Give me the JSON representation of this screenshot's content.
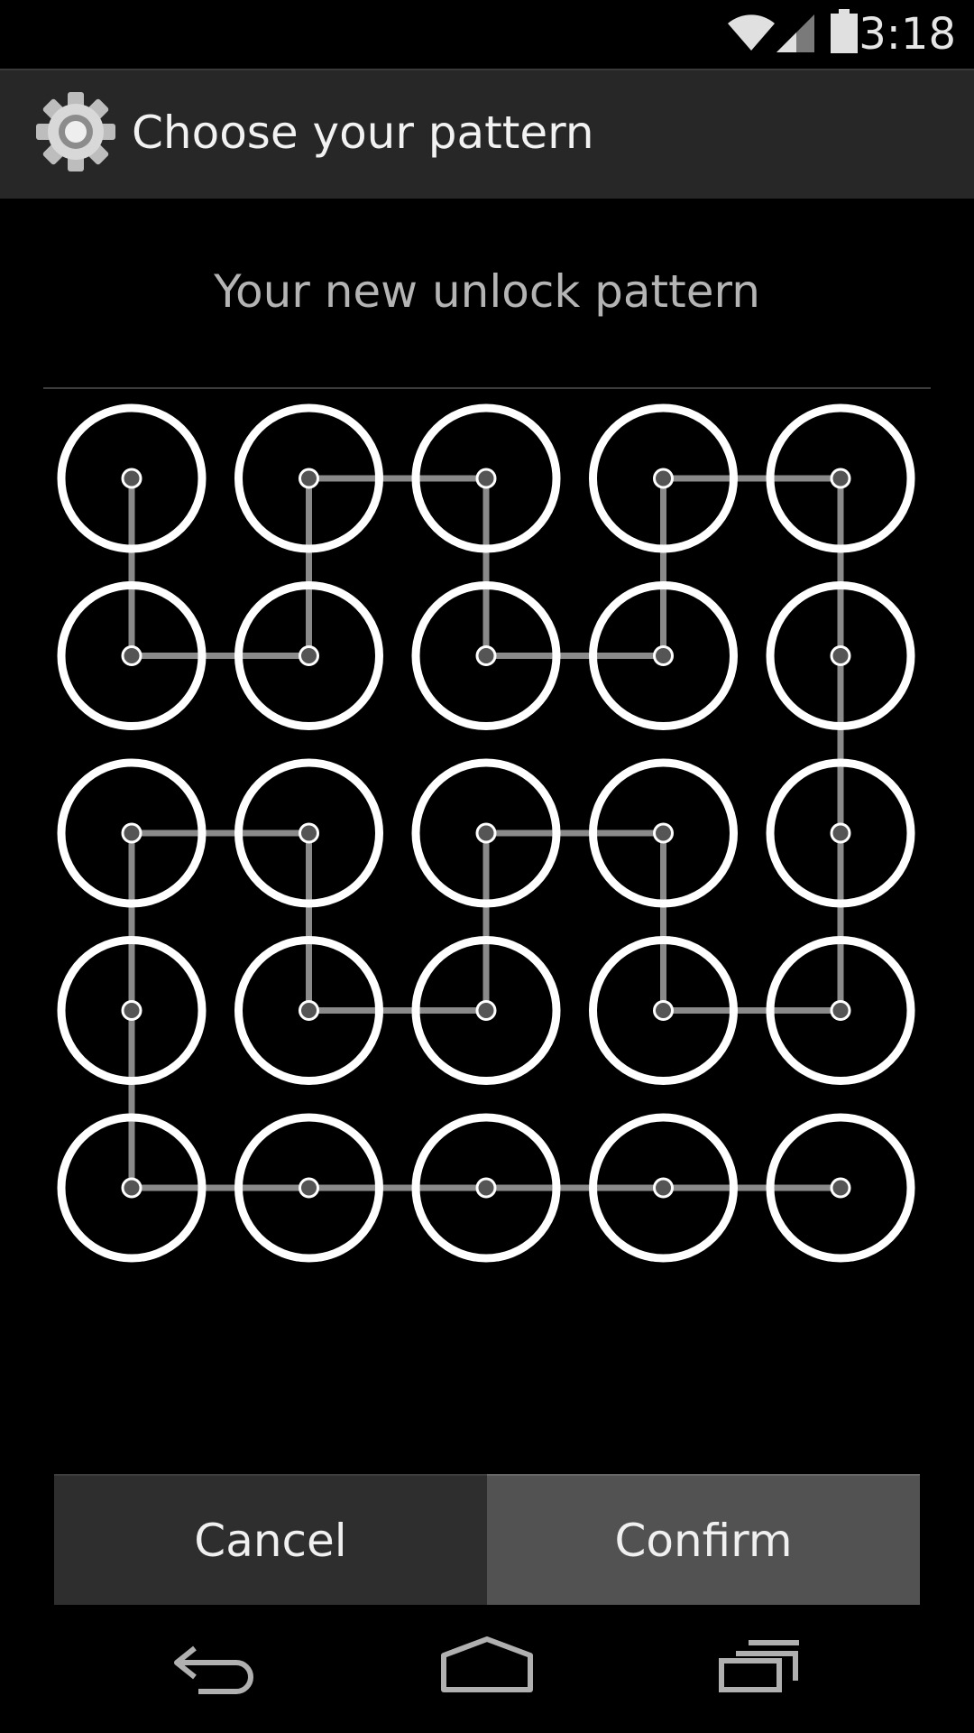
{
  "status_bar": {
    "time": "3:18",
    "icons": [
      "wifi-icon",
      "cell-signal-icon",
      "battery-icon"
    ]
  },
  "action_bar": {
    "title": "Choose your pattern",
    "icon": "settings-gear-icon"
  },
  "header": {
    "text": "Your new unlock pattern"
  },
  "pattern": {
    "rows": 5,
    "cols": 5,
    "dot_color": "#ffffff",
    "line_color": "#8a8a8a",
    "path": [
      [
        1,
        5
      ],
      [
        2,
        5
      ],
      [
        3,
        5
      ],
      [
        4,
        5
      ],
      [
        5,
        5
      ],
      [
        5,
        4
      ],
      [
        4,
        4
      ],
      [
        4,
        3
      ],
      [
        3,
        3
      ],
      [
        3,
        4
      ],
      [
        2,
        4
      ],
      [
        2,
        3
      ],
      [
        1,
        3
      ],
      [
        1,
        2
      ],
      [
        2,
        2
      ],
      [
        2,
        1
      ],
      [
        3,
        1
      ],
      [
        3,
        2
      ],
      [
        4,
        2
      ],
      [
        4,
        1
      ],
      [
        5,
        1
      ],
      [
        5,
        2
      ],
      [
        5,
        3
      ],
      [
        5,
        4
      ]
    ],
    "segments": [
      [
        [
          1,
          1
        ],
        [
          1,
          2
        ]
      ],
      [
        [
          1,
          2
        ],
        [
          2,
          2
        ]
      ],
      [
        [
          2,
          2
        ],
        [
          2,
          1
        ]
      ],
      [
        [
          2,
          1
        ],
        [
          3,
          1
        ]
      ],
      [
        [
          3,
          1
        ],
        [
          3,
          2
        ]
      ],
      [
        [
          3,
          2
        ],
        [
          4,
          2
        ]
      ],
      [
        [
          4,
          2
        ],
        [
          4,
          1
        ]
      ],
      [
        [
          4,
          1
        ],
        [
          5,
          1
        ]
      ],
      [
        [
          5,
          1
        ],
        [
          5,
          4
        ]
      ],
      [
        [
          1,
          3
        ],
        [
          2,
          3
        ]
      ],
      [
        [
          2,
          3
        ],
        [
          2,
          4
        ]
      ],
      [
        [
          2,
          4
        ],
        [
          3,
          4
        ]
      ],
      [
        [
          3,
          4
        ],
        [
          3,
          3
        ]
      ],
      [
        [
          3,
          3
        ],
        [
          4,
          3
        ]
      ],
      [
        [
          4,
          3
        ],
        [
          4,
          4
        ]
      ],
      [
        [
          4,
          4
        ],
        [
          5,
          4
        ]
      ],
      [
        [
          1,
          3
        ],
        [
          1,
          5
        ]
      ],
      [
        [
          1,
          5
        ],
        [
          5,
          5
        ]
      ]
    ]
  },
  "buttons": {
    "cancel": "Cancel",
    "confirm": "Confirm"
  },
  "nav_bar": {
    "icons": [
      "back-icon",
      "home-icon",
      "recent-apps-icon"
    ]
  },
  "colors": {
    "background": "#000000",
    "action_bar": "#272727",
    "cancel_button": "#2e2e2e",
    "confirm_button": "#525252",
    "header_text": "#b4b4b4"
  }
}
